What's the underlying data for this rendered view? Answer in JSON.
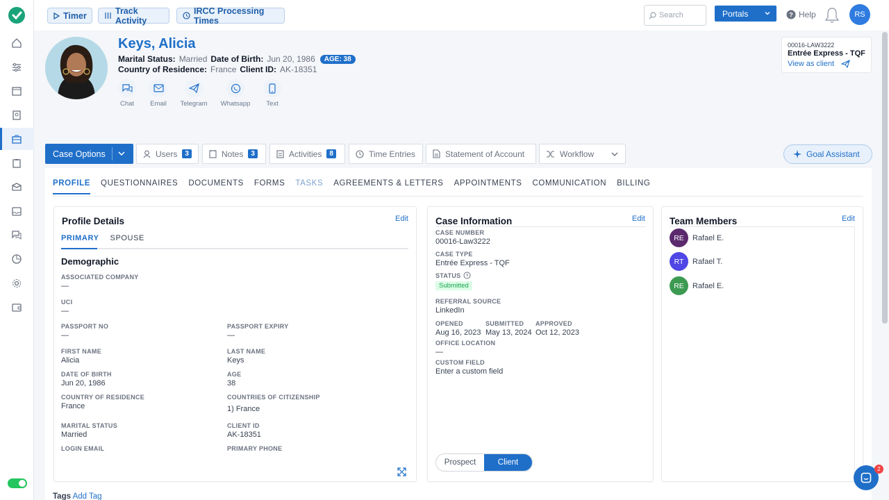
{
  "topbar": {
    "timer_label": "Timer",
    "track_label": "Track Activity",
    "ircc_label": "IRCC Processing Times",
    "search_placeholder": "Search",
    "portals_label": "Portals",
    "help_label": "Help",
    "user_initials": "RS"
  },
  "client": {
    "name": "Keys, Alicia",
    "marital_status_label": "Marital Status:",
    "marital_status": "Married",
    "dob_label": "Date of Birth:",
    "dob": "Jun 20, 1986",
    "age_badge": "AGE: 38",
    "country_label": "Country of Residence:",
    "country": "France",
    "client_id_label": "Client ID:",
    "client_id": "AK-18351"
  },
  "contacts": [
    "Chat",
    "Email",
    "Telegram",
    "Whatsapp",
    "Text"
  ],
  "case_card": {
    "number": "00016-LAW3222",
    "type": "Entrée Express - TQF",
    "view_label": "View as client"
  },
  "actions": {
    "case_options": "Case Options",
    "users": "Users",
    "users_count": "3",
    "notes": "Notes",
    "notes_count": "3",
    "activities": "Activities",
    "activities_count": "8",
    "time_entries": "Time Entries",
    "statement": "Statement of Account",
    "workflow": "Workflow",
    "goal_assistant": "Goal Assistant"
  },
  "tabs": [
    "PROFILE",
    "QUESTIONNAIRES",
    "DOCUMENTS",
    "FORMS",
    "TASKS",
    "AGREEMENTS & LETTERS",
    "APPOINTMENTS",
    "COMMUNICATION",
    "BILLING"
  ],
  "profile": {
    "title": "Profile Details",
    "edit": "Edit",
    "subtab_primary": "PRIMARY",
    "subtab_spouse": "SPOUSE",
    "section": "Demographic",
    "associated_company_label": "ASSOCIATED COMPANY",
    "associated_company": "—",
    "uci_label": "UCI",
    "uci": "—",
    "passport_no_label": "PASSPORT NO",
    "passport_no": "—",
    "passport_expiry_label": "PASSPORT EXPIRY",
    "passport_expiry": "—",
    "first_name_label": "FIRST NAME",
    "first_name": "Alicia",
    "last_name_label": "LAST NAME",
    "last_name": "Keys",
    "dob_label": "DATE OF BIRTH",
    "dob": "Jun 20, 1986",
    "age_label": "AGE",
    "age": "38",
    "country_label": "COUNTRY OF RESIDENCE",
    "country": "France",
    "citizenship_label": "COUNTRIES OF CITIZENSHIP",
    "citizenship": "1) France",
    "marital_label": "MARITAL STATUS",
    "marital": "Married",
    "client_id_label": "CLIENT ID",
    "client_id": "AK-18351",
    "login_email_label": "LOGIN EMAIL",
    "primary_phone_label": "PRIMARY PHONE"
  },
  "case_info": {
    "title": "Case Information",
    "edit": "Edit",
    "case_number_label": "CASE NUMBER",
    "case_number": "00016-Law3222",
    "case_type_label": "CASE TYPE",
    "case_type": "Entrée Express - TQF",
    "status_label": "STATUS",
    "status": "Submitted",
    "referral_label": "REFERRAL SOURCE",
    "referral": "LinkedIn",
    "opened_label": "OPENED",
    "opened": "Aug 16, 2023",
    "submitted_label": "SUBMITTED",
    "submitted": "May 13, 2024",
    "approved_label": "APPROVED",
    "approved": "Oct 12, 2023",
    "office_label": "OFFICE LOCATION",
    "office": "—",
    "custom_label": "CUSTOM FIELD",
    "custom": "Enter a custom field",
    "prospect_label": "Prospect",
    "client_label": "Client"
  },
  "team": {
    "title": "Team Members",
    "edit": "Edit",
    "members": [
      {
        "initials": "RE",
        "name": "Rafael E.",
        "color": "#5b2a6e"
      },
      {
        "initials": "RT",
        "name": "Rafael T.",
        "color": "#4f46e5"
      },
      {
        "initials": "RE",
        "name": "Rafael E.",
        "color": "#3c9a52"
      }
    ]
  },
  "tags": {
    "label": "Tags",
    "add": "Add Tag"
  },
  "notifications": {
    "chat_badge": "2"
  }
}
